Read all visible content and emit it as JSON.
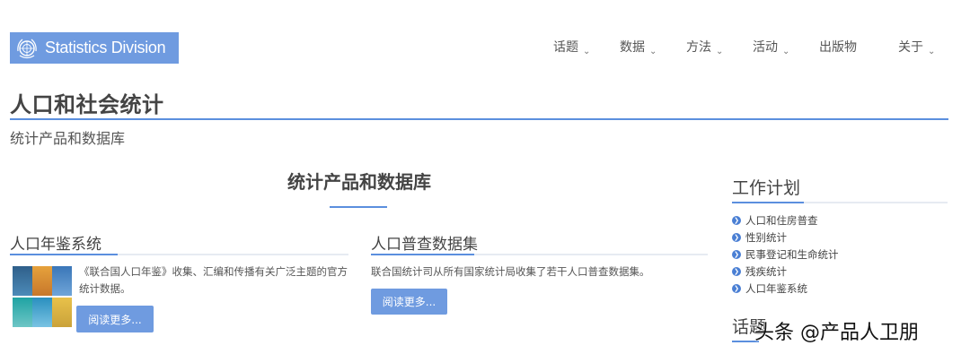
{
  "brand": {
    "name": "Statistics Division",
    "logo_color": "#6f9be0"
  },
  "nav": [
    {
      "label": "话题",
      "dropdown": true
    },
    {
      "label": "数据",
      "dropdown": true
    },
    {
      "label": "方法",
      "dropdown": true
    },
    {
      "label": "活动",
      "dropdown": true
    },
    {
      "label": "出版物",
      "dropdown": false
    },
    {
      "label": "关于",
      "dropdown": true
    }
  ],
  "page": {
    "title": "人口和社会统计",
    "breadcrumb": "统计产品和数据库",
    "section_heading": "统计产品和数据库",
    "accent_color": "#5b8fde"
  },
  "cards": [
    {
      "title": "人口年鉴系统",
      "description": "《联合国人口年鉴》收集、汇编和传播有关广泛主题的官方统计数据。",
      "button": "阅读更多..."
    },
    {
      "title": "人口普查数据集",
      "description": "联合国统计司从所有国家统计局收集了若干人口普查数据集。",
      "button": "阅读更多..."
    }
  ],
  "sidebar": {
    "title": "工作计划",
    "items": [
      "人口和住房普查",
      "性别统计",
      "民事登记和生命统计",
      "残疾统计",
      "人口年鉴系统"
    ],
    "title2": "话题"
  },
  "watermark": "头条 @产品人卫朋",
  "icons": {
    "bullet": "chevron-right-circle-icon",
    "dropdown": "chevron-down-icon",
    "logo": "un-emblem-icon"
  }
}
